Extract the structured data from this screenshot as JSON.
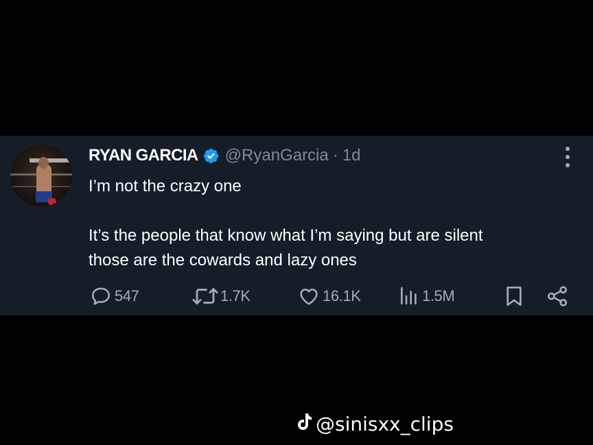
{
  "tweet": {
    "author": {
      "display_name": "RYAN GARCIA",
      "handle": "@RyanGarcia",
      "verified_icon": "verified-badge-icon",
      "verified_color": "#1d9bf0"
    },
    "separator": "·",
    "timestamp": "1d",
    "text_lines": [
      "I’m not the crazy one",
      "It’s the people that know what I’m saying but are silent",
      "those are the cowards and lazy ones"
    ],
    "stats": {
      "replies": "547",
      "reposts": "1.7K",
      "likes": "16.1K",
      "views": "1.5M"
    },
    "icons": {
      "reply": "reply-bubble-icon",
      "repost": "repost-icon",
      "like": "heart-icon",
      "views": "views-bar-chart-icon",
      "bookmark": "bookmark-icon",
      "share": "share-icon",
      "more": "more-options-icon"
    },
    "colors": {
      "background": "#151d28",
      "text": "#ffffff",
      "secondary_text": "#7e8a97",
      "icon": "#a3acb6"
    }
  },
  "watermark": {
    "icon": "tiktok-icon",
    "text": "@sinisxx_clips"
  }
}
